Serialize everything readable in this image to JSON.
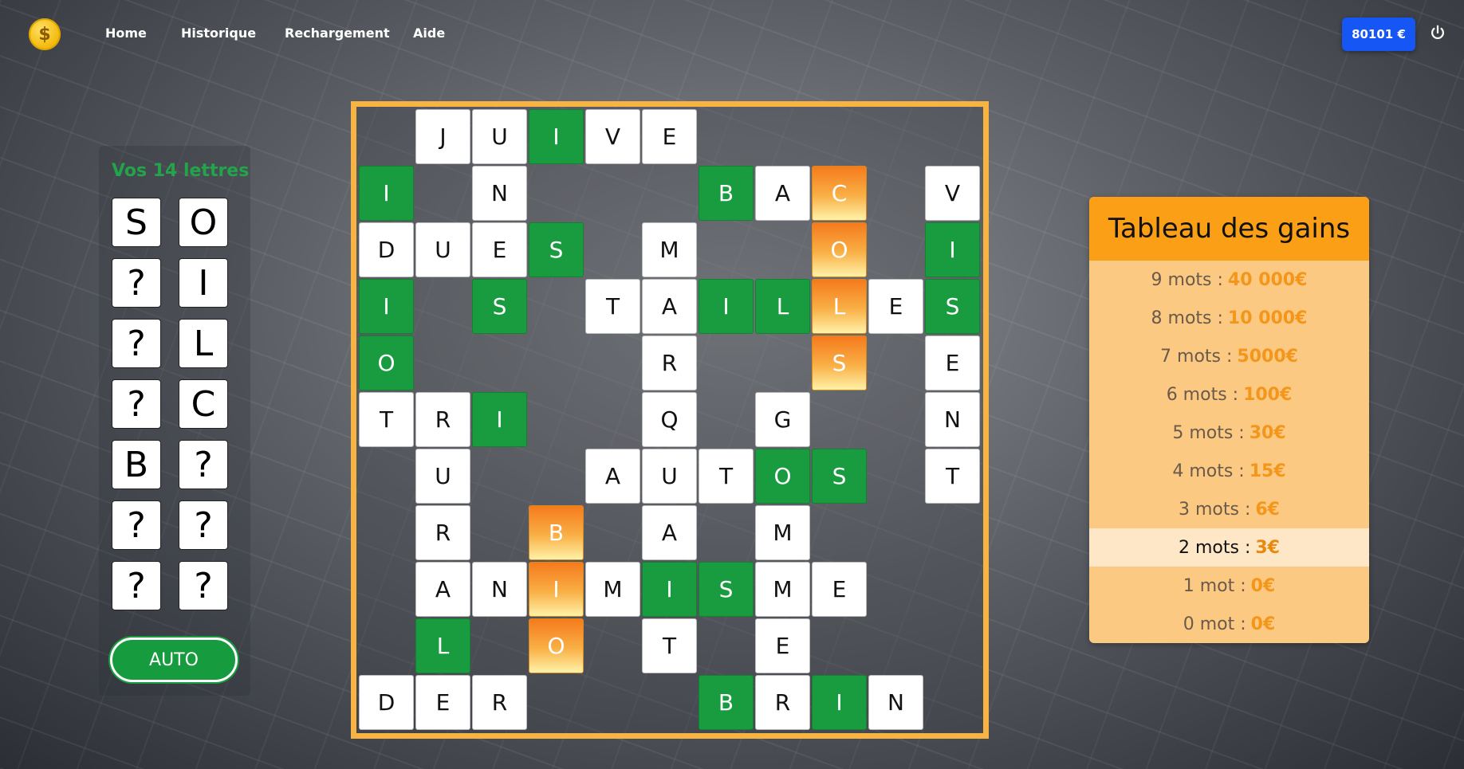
{
  "nav": {
    "logo_icon": "dollar-coin-icon",
    "links": [
      "Home",
      "Historique",
      "Rechargement",
      "Aide"
    ],
    "balance": "80101 €",
    "power_icon": "power-icon"
  },
  "letters": {
    "title": "Vos 14 lettres",
    "tiles": [
      "S",
      "O",
      "?",
      "I",
      "?",
      "L",
      "?",
      "C",
      "B",
      "?",
      "?",
      "?",
      "?",
      "?"
    ],
    "auto_label": "AUTO"
  },
  "board": {
    "size": 11,
    "colors": {
      "white": "#ffffff",
      "green": "#199b3f",
      "orange": "#f7a238",
      "frame": "#f7b443"
    },
    "rows": [
      [
        null,
        [
          "J",
          "w"
        ],
        [
          "U",
          "w"
        ],
        [
          "I",
          "g"
        ],
        [
          "V",
          "w"
        ],
        [
          "E",
          "w"
        ],
        null,
        null,
        null,
        null,
        null
      ],
      [
        [
          "I",
          "g"
        ],
        null,
        [
          "N",
          "w"
        ],
        null,
        null,
        null,
        [
          "B",
          "g"
        ],
        [
          "A",
          "w"
        ],
        [
          "C",
          "o"
        ],
        null,
        [
          "V",
          "w"
        ]
      ],
      [
        [
          "D",
          "w"
        ],
        [
          "U",
          "w"
        ],
        [
          "E",
          "w"
        ],
        [
          "S",
          "g"
        ],
        null,
        [
          "M",
          "w"
        ],
        null,
        null,
        [
          "O",
          "o"
        ],
        null,
        [
          "I",
          "g"
        ]
      ],
      [
        [
          "I",
          "g"
        ],
        null,
        [
          "S",
          "g"
        ],
        null,
        [
          "T",
          "w"
        ],
        [
          "A",
          "w"
        ],
        [
          "I",
          "g"
        ],
        [
          "L",
          "g"
        ],
        [
          "L",
          "o"
        ],
        [
          "E",
          "w"
        ],
        [
          "S",
          "g"
        ]
      ],
      [
        [
          "O",
          "g"
        ],
        null,
        null,
        null,
        null,
        [
          "R",
          "w"
        ],
        null,
        null,
        [
          "S",
          "o"
        ],
        null,
        [
          "E",
          "w"
        ]
      ],
      [
        [
          "T",
          "w"
        ],
        [
          "R",
          "w"
        ],
        [
          "I",
          "g"
        ],
        null,
        null,
        [
          "Q",
          "w"
        ],
        null,
        [
          "G",
          "w"
        ],
        null,
        null,
        [
          "N",
          "w"
        ]
      ],
      [
        null,
        [
          "U",
          "w"
        ],
        null,
        null,
        [
          "A",
          "w"
        ],
        [
          "U",
          "w"
        ],
        [
          "T",
          "w"
        ],
        [
          "O",
          "g"
        ],
        [
          "S",
          "g"
        ],
        null,
        [
          "T",
          "w"
        ]
      ],
      [
        null,
        [
          "R",
          "w"
        ],
        null,
        [
          "B",
          "o"
        ],
        null,
        [
          "A",
          "w"
        ],
        null,
        [
          "M",
          "w"
        ],
        null,
        null,
        null
      ],
      [
        null,
        [
          "A",
          "w"
        ],
        [
          "N",
          "w"
        ],
        [
          "I",
          "o"
        ],
        [
          "M",
          "w"
        ],
        [
          "I",
          "g"
        ],
        [
          "S",
          "g"
        ],
        [
          "M",
          "w"
        ],
        [
          "E",
          "w"
        ],
        null,
        null
      ],
      [
        null,
        [
          "L",
          "g"
        ],
        null,
        [
          "O",
          "o"
        ],
        null,
        [
          "T",
          "w"
        ],
        null,
        [
          "E",
          "w"
        ],
        null,
        null,
        null
      ],
      [
        [
          "D",
          "w"
        ],
        [
          "E",
          "w"
        ],
        [
          "R",
          "w"
        ],
        null,
        null,
        null,
        [
          "B",
          "g"
        ],
        [
          "R",
          "w"
        ],
        [
          "I",
          "g"
        ],
        [
          "N",
          "w"
        ],
        null
      ]
    ]
  },
  "prize_table": {
    "title": "Tableau des gains",
    "highlight_index": 7,
    "rows": [
      {
        "label": "9 mots :",
        "amount": "40 000€"
      },
      {
        "label": "8 mots :",
        "amount": "10 000€"
      },
      {
        "label": "7 mots :",
        "amount": "5000€"
      },
      {
        "label": "6 mots :",
        "amount": "100€"
      },
      {
        "label": "5 mots :",
        "amount": "30€"
      },
      {
        "label": "4 mots :",
        "amount": "15€"
      },
      {
        "label": "3 mots :",
        "amount": "6€"
      },
      {
        "label": "2 mots :",
        "amount": "3€"
      },
      {
        "label": "1 mot :",
        "amount": "0€"
      },
      {
        "label": "0 mot :",
        "amount": "0€"
      }
    ]
  }
}
